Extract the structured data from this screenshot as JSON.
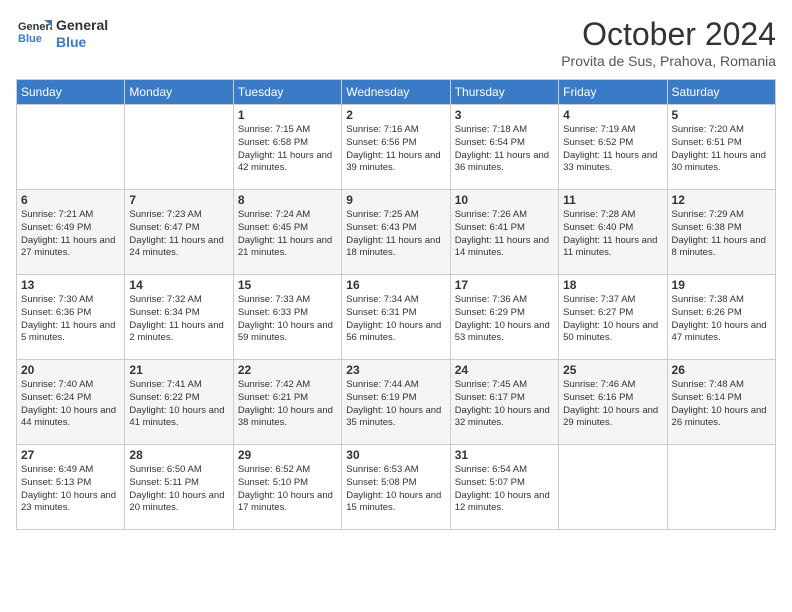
{
  "header": {
    "logo_line1": "General",
    "logo_line2": "Blue",
    "month": "October 2024",
    "location": "Provita de Sus, Prahova, Romania"
  },
  "days_of_week": [
    "Sunday",
    "Monday",
    "Tuesday",
    "Wednesday",
    "Thursday",
    "Friday",
    "Saturday"
  ],
  "weeks": [
    [
      {
        "day": "",
        "detail": ""
      },
      {
        "day": "",
        "detail": ""
      },
      {
        "day": "1",
        "detail": "Sunrise: 7:15 AM\nSunset: 6:58 PM\nDaylight: 11 hours and 42 minutes."
      },
      {
        "day": "2",
        "detail": "Sunrise: 7:16 AM\nSunset: 6:56 PM\nDaylight: 11 hours and 39 minutes."
      },
      {
        "day": "3",
        "detail": "Sunrise: 7:18 AM\nSunset: 6:54 PM\nDaylight: 11 hours and 36 minutes."
      },
      {
        "day": "4",
        "detail": "Sunrise: 7:19 AM\nSunset: 6:52 PM\nDaylight: 11 hours and 33 minutes."
      },
      {
        "day": "5",
        "detail": "Sunrise: 7:20 AM\nSunset: 6:51 PM\nDaylight: 11 hours and 30 minutes."
      }
    ],
    [
      {
        "day": "6",
        "detail": "Sunrise: 7:21 AM\nSunset: 6:49 PM\nDaylight: 11 hours and 27 minutes."
      },
      {
        "day": "7",
        "detail": "Sunrise: 7:23 AM\nSunset: 6:47 PM\nDaylight: 11 hours and 24 minutes."
      },
      {
        "day": "8",
        "detail": "Sunrise: 7:24 AM\nSunset: 6:45 PM\nDaylight: 11 hours and 21 minutes."
      },
      {
        "day": "9",
        "detail": "Sunrise: 7:25 AM\nSunset: 6:43 PM\nDaylight: 11 hours and 18 minutes."
      },
      {
        "day": "10",
        "detail": "Sunrise: 7:26 AM\nSunset: 6:41 PM\nDaylight: 11 hours and 14 minutes."
      },
      {
        "day": "11",
        "detail": "Sunrise: 7:28 AM\nSunset: 6:40 PM\nDaylight: 11 hours and 11 minutes."
      },
      {
        "day": "12",
        "detail": "Sunrise: 7:29 AM\nSunset: 6:38 PM\nDaylight: 11 hours and 8 minutes."
      }
    ],
    [
      {
        "day": "13",
        "detail": "Sunrise: 7:30 AM\nSunset: 6:36 PM\nDaylight: 11 hours and 5 minutes."
      },
      {
        "day": "14",
        "detail": "Sunrise: 7:32 AM\nSunset: 6:34 PM\nDaylight: 11 hours and 2 minutes."
      },
      {
        "day": "15",
        "detail": "Sunrise: 7:33 AM\nSunset: 6:33 PM\nDaylight: 10 hours and 59 minutes."
      },
      {
        "day": "16",
        "detail": "Sunrise: 7:34 AM\nSunset: 6:31 PM\nDaylight: 10 hours and 56 minutes."
      },
      {
        "day": "17",
        "detail": "Sunrise: 7:36 AM\nSunset: 6:29 PM\nDaylight: 10 hours and 53 minutes."
      },
      {
        "day": "18",
        "detail": "Sunrise: 7:37 AM\nSunset: 6:27 PM\nDaylight: 10 hours and 50 minutes."
      },
      {
        "day": "19",
        "detail": "Sunrise: 7:38 AM\nSunset: 6:26 PM\nDaylight: 10 hours and 47 minutes."
      }
    ],
    [
      {
        "day": "20",
        "detail": "Sunrise: 7:40 AM\nSunset: 6:24 PM\nDaylight: 10 hours and 44 minutes."
      },
      {
        "day": "21",
        "detail": "Sunrise: 7:41 AM\nSunset: 6:22 PM\nDaylight: 10 hours and 41 minutes."
      },
      {
        "day": "22",
        "detail": "Sunrise: 7:42 AM\nSunset: 6:21 PM\nDaylight: 10 hours and 38 minutes."
      },
      {
        "day": "23",
        "detail": "Sunrise: 7:44 AM\nSunset: 6:19 PM\nDaylight: 10 hours and 35 minutes."
      },
      {
        "day": "24",
        "detail": "Sunrise: 7:45 AM\nSunset: 6:17 PM\nDaylight: 10 hours and 32 minutes."
      },
      {
        "day": "25",
        "detail": "Sunrise: 7:46 AM\nSunset: 6:16 PM\nDaylight: 10 hours and 29 minutes."
      },
      {
        "day": "26",
        "detail": "Sunrise: 7:48 AM\nSunset: 6:14 PM\nDaylight: 10 hours and 26 minutes."
      }
    ],
    [
      {
        "day": "27",
        "detail": "Sunrise: 6:49 AM\nSunset: 5:13 PM\nDaylight: 10 hours and 23 minutes."
      },
      {
        "day": "28",
        "detail": "Sunrise: 6:50 AM\nSunset: 5:11 PM\nDaylight: 10 hours and 20 minutes."
      },
      {
        "day": "29",
        "detail": "Sunrise: 6:52 AM\nSunset: 5:10 PM\nDaylight: 10 hours and 17 minutes."
      },
      {
        "day": "30",
        "detail": "Sunrise: 6:53 AM\nSunset: 5:08 PM\nDaylight: 10 hours and 15 minutes."
      },
      {
        "day": "31",
        "detail": "Sunrise: 6:54 AM\nSunset: 5:07 PM\nDaylight: 10 hours and 12 minutes."
      },
      {
        "day": "",
        "detail": ""
      },
      {
        "day": "",
        "detail": ""
      }
    ]
  ]
}
